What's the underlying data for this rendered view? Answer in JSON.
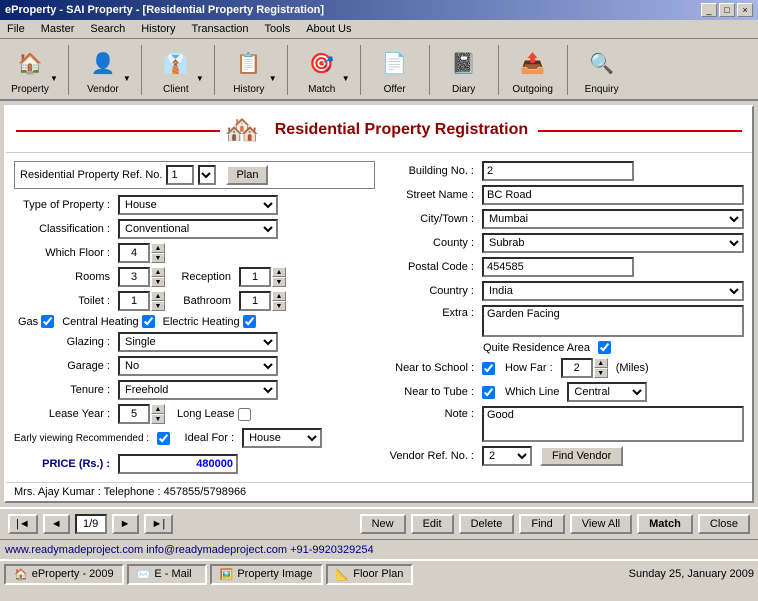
{
  "titleBar": {
    "text": "eProperty - SAI Property - [Residential Property Registration]",
    "buttons": [
      "_",
      "□",
      "×"
    ]
  },
  "menuBar": {
    "items": [
      "File",
      "Master",
      "Search",
      "History",
      "Transaction",
      "Tools",
      "About Us"
    ]
  },
  "toolbar": {
    "items": [
      {
        "label": "Property",
        "icon": "🏠"
      },
      {
        "label": "Vendor",
        "icon": "👤"
      },
      {
        "label": "Client",
        "icon": "👔"
      },
      {
        "label": "History",
        "icon": "📋"
      },
      {
        "label": "Match",
        "icon": "🎯"
      },
      {
        "label": "Offer",
        "icon": "📄"
      },
      {
        "label": "Diary",
        "icon": "📓"
      },
      {
        "label": "Outgoing",
        "icon": "📤"
      },
      {
        "label": "Enquiry",
        "icon": "🔍"
      }
    ]
  },
  "header": {
    "title": "Residential Property Registration"
  },
  "leftPanel": {
    "refLabel": "Residential Property Ref. No.",
    "refValue": "1",
    "planBtn": "Plan",
    "fields": {
      "typeOfProperty": {
        "label": "Type of Property :",
        "value": "House"
      },
      "classification": {
        "label": "Classification :",
        "value": "Conventional"
      },
      "whichFloor": {
        "label": "Which Floor :",
        "value": "4"
      },
      "rooms": {
        "label": "Rooms",
        "value": "3"
      },
      "reception": {
        "label": "Reception",
        "value": "1"
      },
      "toilet": {
        "label": "Toilet :",
        "value": "1"
      },
      "bathroom": {
        "label": "Bathroom",
        "value": "1"
      },
      "gasLabel": "Gas",
      "centralHeatingLabel": "Central Heating",
      "electricHeatingLabel": "Electric Heating",
      "glazing": {
        "label": "Glazing :",
        "value": "Single"
      },
      "garage": {
        "label": "Garage :",
        "value": "No"
      },
      "tenure": {
        "label": "Tenure :",
        "value": "Freehold"
      },
      "leaseYear": {
        "label": "Lease Year :",
        "value": "5"
      },
      "longLease": "Long Lease",
      "earlyViewing": "Early viewing Recommended :",
      "idealFor": {
        "label": "Ideal For :",
        "value": "House"
      }
    },
    "price": {
      "label": "PRICE  (Rs.) :",
      "value": "480000"
    }
  },
  "rightPanel": {
    "buildingNo": {
      "label": "Building No. :",
      "value": "2"
    },
    "streetName": {
      "label": "Street Name :",
      "value": "BC Road"
    },
    "cityTown": {
      "label": "City/Town :",
      "value": "Mumbai"
    },
    "county": {
      "label": "County :",
      "value": "Subrab"
    },
    "postalCode": {
      "label": "Postal Code :",
      "value": "454585"
    },
    "country": {
      "label": "Country :",
      "value": "India"
    },
    "extra": {
      "label": "Extra :",
      "value": "Garden Facing"
    },
    "quiteResidenceArea": "Quite Residence Area",
    "nearToSchool": {
      "label": "Near to School :",
      "howFar": "2",
      "miles": "(Miles)"
    },
    "nearToTube": {
      "label": "Near to Tube :",
      "whichLine": "Central"
    },
    "note": {
      "label": "Note :",
      "value": "Good"
    },
    "vendorRefNo": {
      "label": "Vendor Ref. No. :",
      "value": "2",
      "findBtn": "Find Vendor"
    },
    "vendorInfo": "Mrs. Ajay Kumar : Telephone : 457855/5798966"
  },
  "navBar": {
    "firstBtn": "|◄",
    "prevBtn": "◄",
    "pageValue": "1/9",
    "nextBtn": "►",
    "lastBtn": "►|",
    "newBtn": "New",
    "editBtn": "Edit",
    "deleteBtn": "Delete",
    "findBtn": "Find",
    "viewAllBtn": "View All",
    "matchBtn": "Match",
    "closeBtn": "Close"
  },
  "statusBar": {
    "text": "www.readymadeproject.com  info@readymadeproject.com  +91-9920329254"
  },
  "taskbar": {
    "appLabel": "eProperty - 2009",
    "emailLabel": "E - Mail",
    "propertyImageLabel": "Property Image",
    "floorPlanLabel": "Floor Plan",
    "dateLabel": "Sunday 25, January 2009"
  }
}
